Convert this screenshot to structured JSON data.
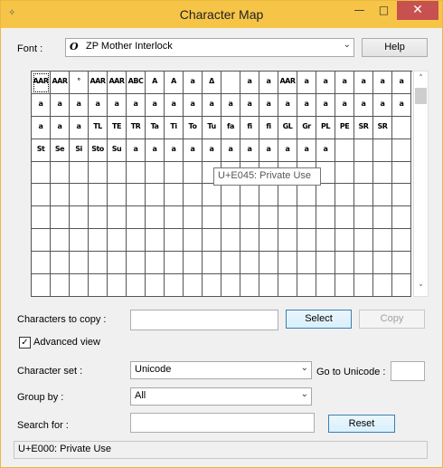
{
  "window": {
    "title": "Character Map",
    "minimize_glyph": "—",
    "maximize_glyph": "□",
    "close_glyph": "✕",
    "accent_color": "#f6c548"
  },
  "font_row": {
    "label": "Font :",
    "font_icon": "O",
    "selected_font": "ZP Mother Interlock",
    "help_button": "Help"
  },
  "grid": {
    "rows": [
      [
        "AAR",
        "AAR",
        "°",
        "AAR",
        "AAR",
        "ABC",
        "A",
        "A",
        "a",
        "Δ",
        "",
        "a",
        "a",
        "AAR",
        "a",
        "a",
        "a",
        "a",
        "a",
        "a"
      ],
      [
        "a",
        "a",
        "a",
        "a",
        "a",
        "a",
        "a",
        "a",
        "a",
        "a",
        "a",
        "a",
        "a",
        "a",
        "a",
        "a",
        "a",
        "a",
        "a",
        "a"
      ],
      [
        "a",
        "a",
        "a",
        "TL",
        "TE",
        "TR",
        "Ta",
        "Ti",
        "To",
        "Tu",
        "fa",
        "fi",
        "fi",
        "GL",
        "Gr",
        "PL",
        "PE",
        "SR",
        "SR",
        ""
      ],
      [
        "St",
        "Se",
        "Si",
        "Sto",
        "Su",
        "a",
        "a",
        "a",
        "a",
        "a",
        "a",
        "a",
        "a",
        "a",
        "a",
        "a",
        "",
        "",
        "",
        ""
      ]
    ],
    "tooltip": "U+E045: Private Use",
    "scroll_up": "˄",
    "scroll_down": "˅"
  },
  "copy_row": {
    "label": "Characters to copy :",
    "value": "",
    "select_button": "Select",
    "copy_button": "Copy"
  },
  "advanced_view": {
    "label": "Advanced view",
    "checked": true,
    "check_glyph": "✓"
  },
  "character_set": {
    "label": "Character set :",
    "value": "Unicode",
    "goto_label": "Go to Unicode :",
    "goto_value": ""
  },
  "group_by": {
    "label": "Group by :",
    "value": "All"
  },
  "search": {
    "label": "Search for :",
    "value": "",
    "reset_button": "Reset"
  },
  "status_bar": {
    "text": "U+E000: Private Use"
  }
}
